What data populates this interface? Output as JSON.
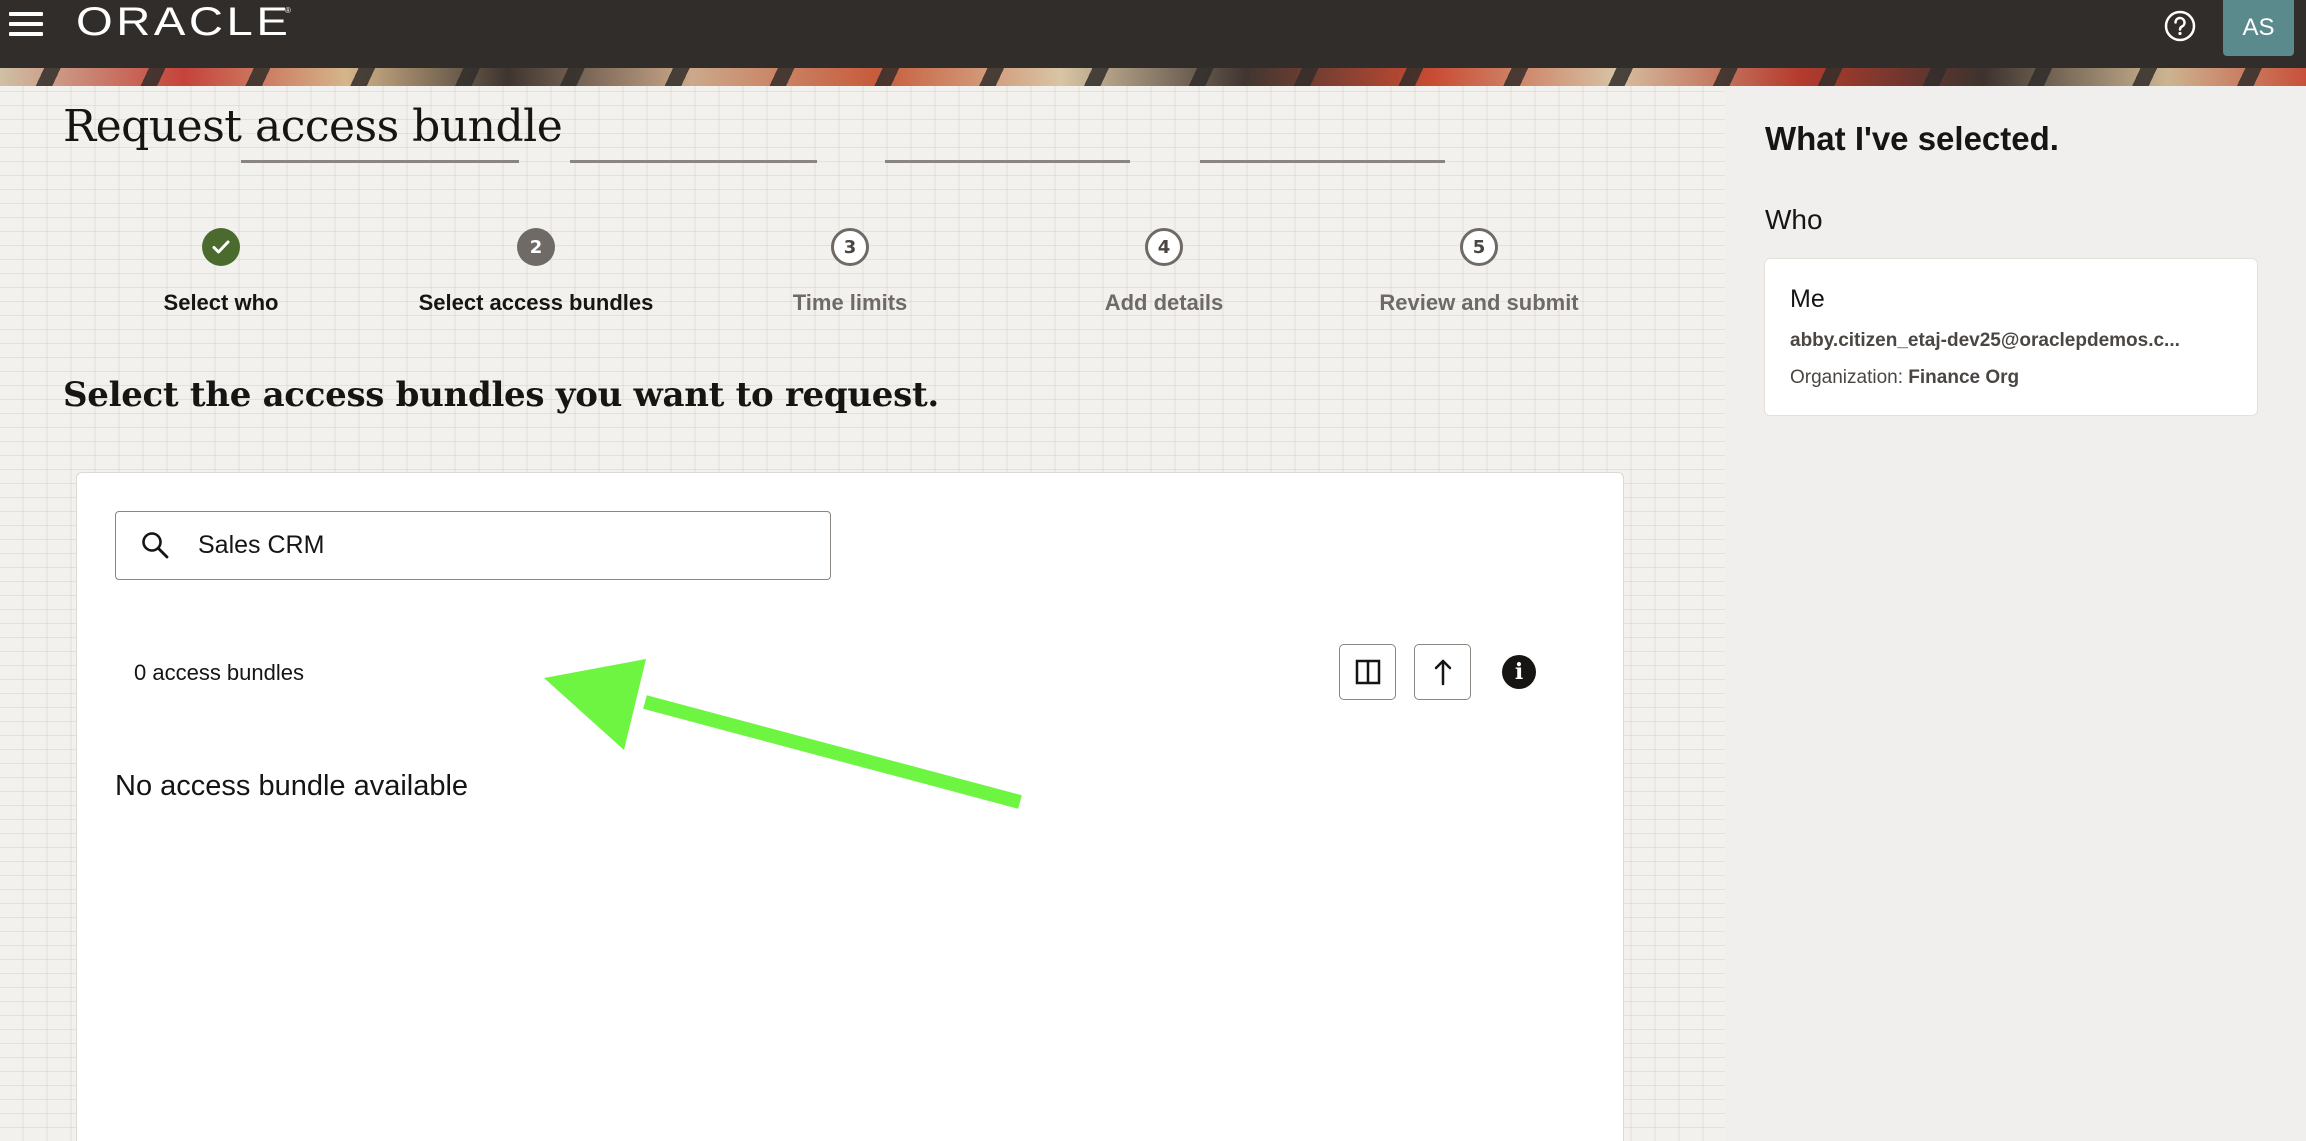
{
  "header": {
    "logo_text": "ORACLE",
    "logo_mark": "®",
    "avatar_initials": "AS"
  },
  "page": {
    "title": "Request access bundle",
    "section_heading": "Select the access bundles you want to request."
  },
  "stepper": {
    "steps": [
      {
        "label": "Select who",
        "number": "1",
        "state": "done"
      },
      {
        "label": "Select access bundles",
        "number": "2",
        "state": "current"
      },
      {
        "label": "Time limits",
        "number": "3",
        "state": "todo"
      },
      {
        "label": "Add details",
        "number": "4",
        "state": "todo"
      },
      {
        "label": "Review and submit",
        "number": "5",
        "state": "todo"
      }
    ]
  },
  "search": {
    "value": "Sales CRM",
    "icon": "search-icon"
  },
  "results": {
    "count_label": "0 access bundles",
    "empty_message": "No access bundle available"
  },
  "toolbar": {
    "columns_icon": "split-columns-icon",
    "sort_icon": "arrow-up-icon",
    "info_icon": "info-icon",
    "info_glyph": "i"
  },
  "selected_panel": {
    "title": "What I've selected.",
    "who_heading": "Who",
    "who": {
      "name": "Me",
      "email": "abby.citizen_etaj-dev25@oraclepdemos.c...",
      "org_label": "Organization:",
      "org_value": "Finance Org"
    }
  },
  "colors": {
    "header_bg": "#312d2a",
    "step_done": "#4b6b2e",
    "step_current": "#6f6a66",
    "annotation_arrow": "#6ef542"
  }
}
